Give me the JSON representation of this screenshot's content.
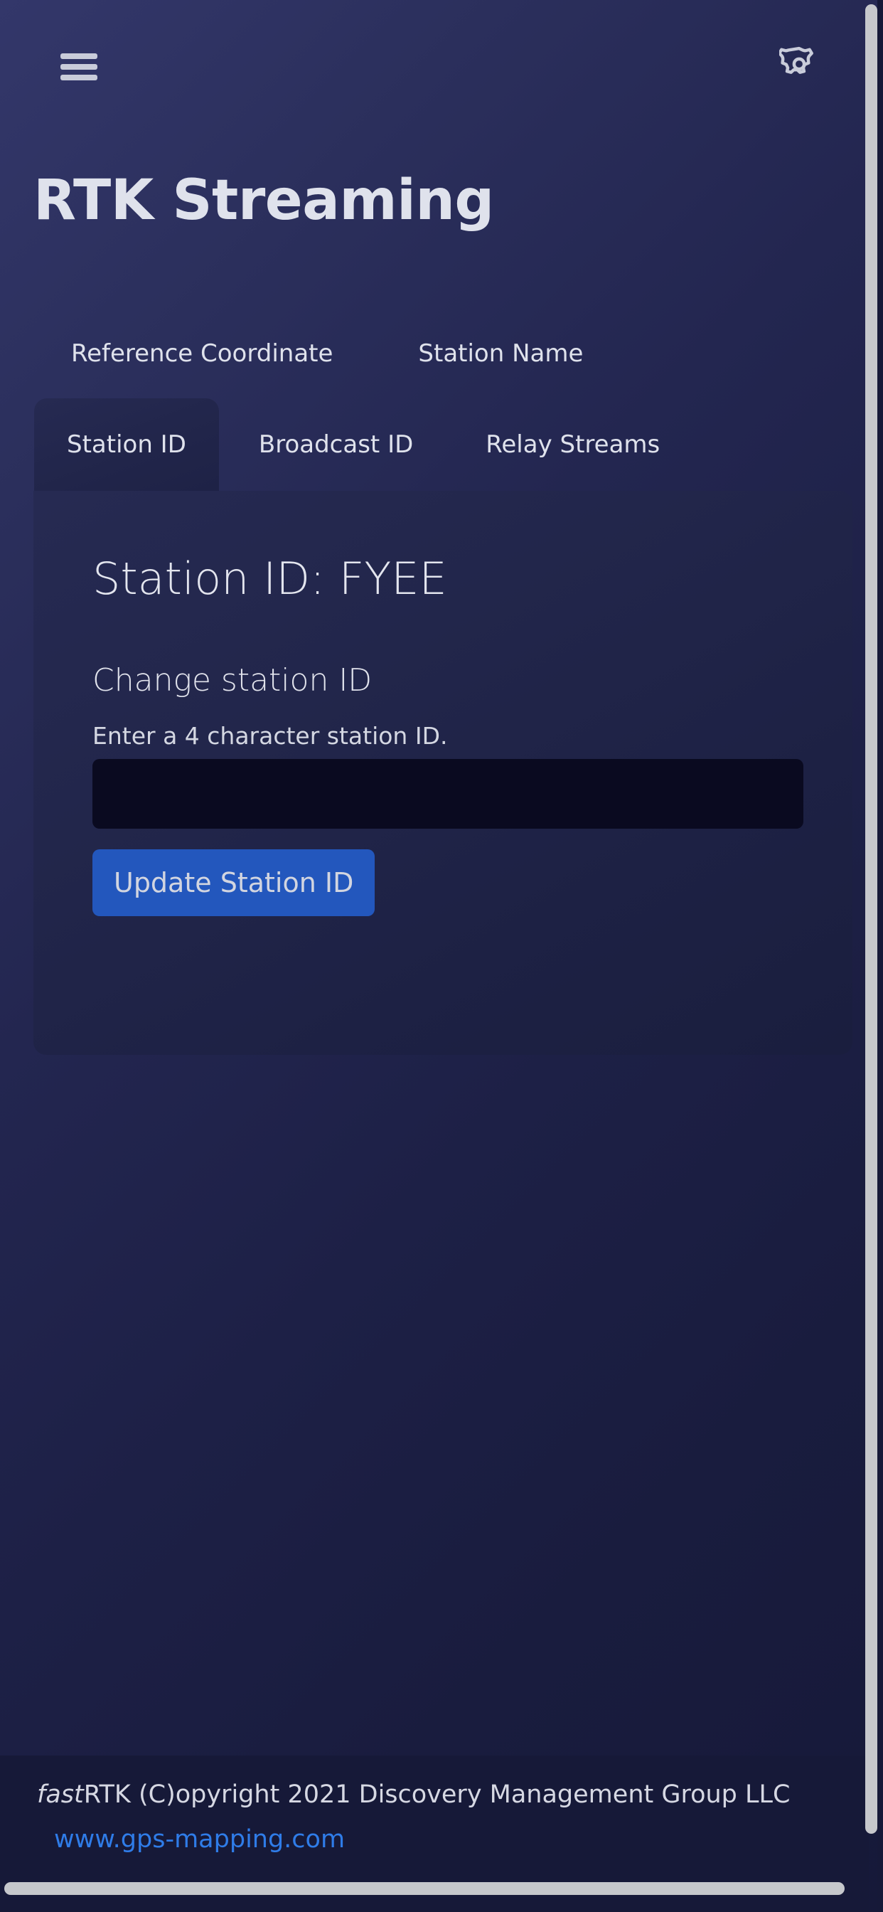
{
  "header": {
    "menu_icon": "hamburger-menu-icon",
    "settings_icon": "gear-icon",
    "title": "RTK Streaming"
  },
  "tabs_primary": [
    {
      "label": "Reference Coordinate",
      "active": false
    },
    {
      "label": "Station Name",
      "active": false
    }
  ],
  "tabs_secondary": [
    {
      "label": "Station ID",
      "active": true
    },
    {
      "label": "Broadcast ID",
      "active": false
    },
    {
      "label": "Relay Streams",
      "active": false
    }
  ],
  "card": {
    "title": "Station ID: FYEE",
    "station_id": "FYEE",
    "section_title": "Change station ID",
    "section_help": "Enter a 4 character station ID.",
    "input_value": "",
    "input_placeholder": "",
    "submit_label": "Update Station ID"
  },
  "footer": {
    "brand_italic": "fast",
    "brand_rest": "RTK",
    "copyright": "  (C)opyright 2021 Discovery Management Group LLC",
    "link": "www.gps-mapping.com"
  },
  "colors": {
    "accent_button": "#2357bd",
    "link": "#2f7ce8",
    "card_bg": "#21254a",
    "input_bg": "#0a0a20",
    "page_bg_start": "#33376a",
    "page_bg_end": "#161939",
    "footer_bg": "#161938",
    "text_primary": "#dfe2ec",
    "scrollbar": "#c6c8cc"
  }
}
